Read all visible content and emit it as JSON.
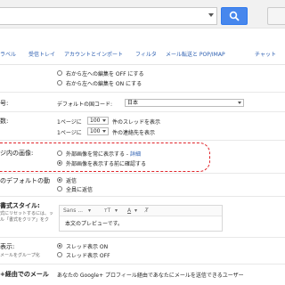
{
  "search": {
    "placeholder": ""
  },
  "tabs": [
    "ラベル",
    "受信トレイ",
    "アカウントとインポート",
    "フィルタ",
    "メール転送と POP/IMAP",
    "チャット"
  ],
  "bidi": {
    "option1": "右から左への編集を OFF にする",
    "option2": "右から左への編集を ON にする"
  },
  "country": {
    "label": "号:",
    "field": "デフォルトの国コード:",
    "value": "日本"
  },
  "page_size": {
    "label": "数:",
    "prefix": "1ページに",
    "threads_value": "100",
    "threads_suffix": "件のスレッドを表示",
    "contacts_value": "100",
    "contacts_suffix": "件の連絡先を表示"
  },
  "images": {
    "label": "ジ内の画像:",
    "option1": "外部画像を常に表示する - ",
    "option1_link": "詳細",
    "option2": "外部画像を表示する前に確認する"
  },
  "reply": {
    "label": "のデフォルトの動",
    "option1": "返信",
    "option2": "全員に返信"
  },
  "text_style": {
    "label": "書式スタイル:",
    "hint1": "式にリセットするには、ッ",
    "hint2": "ル「書式をクリア」をク",
    "font": "Sans ...",
    "size_icon": "тT",
    "preview": "本文のプレビューです。"
  },
  "conversation": {
    "label": "表示:",
    "hint": "メールをグループ化",
    "option1": "スレッド表示 ON",
    "option2": "スレッド表示 OFF"
  },
  "google_plus": {
    "label": "+経由でのメール",
    "text": "あなたの Google+ プロフィール経由であなたにメールを送信できるユーザー"
  }
}
